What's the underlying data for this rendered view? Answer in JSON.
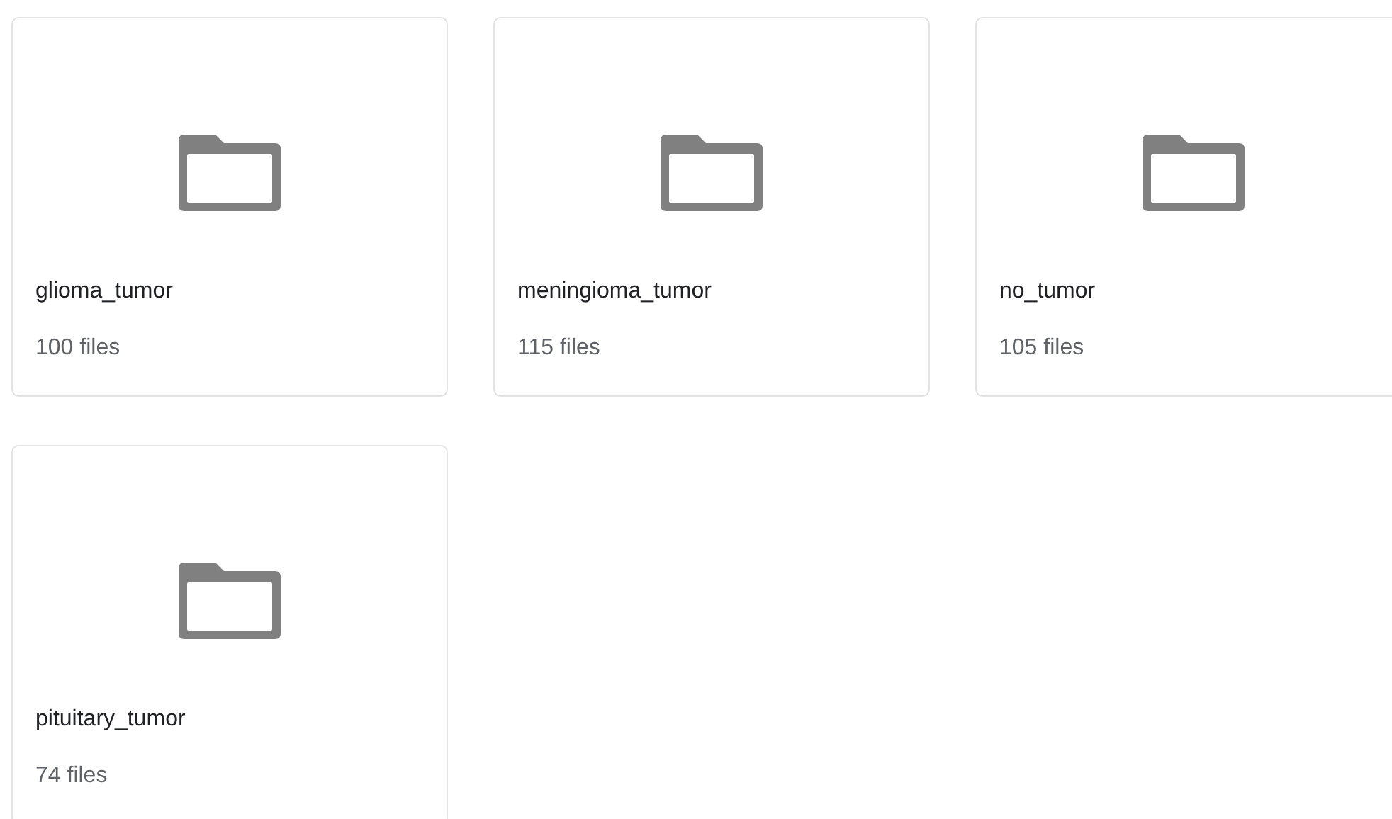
{
  "folders": [
    {
      "name": "glioma_tumor",
      "count": "100 files"
    },
    {
      "name": "meningioma_tumor",
      "count": "115 files"
    },
    {
      "name": "no_tumor",
      "count": "105 files"
    },
    {
      "name": "pituitary_tumor",
      "count": "74 files"
    }
  ]
}
